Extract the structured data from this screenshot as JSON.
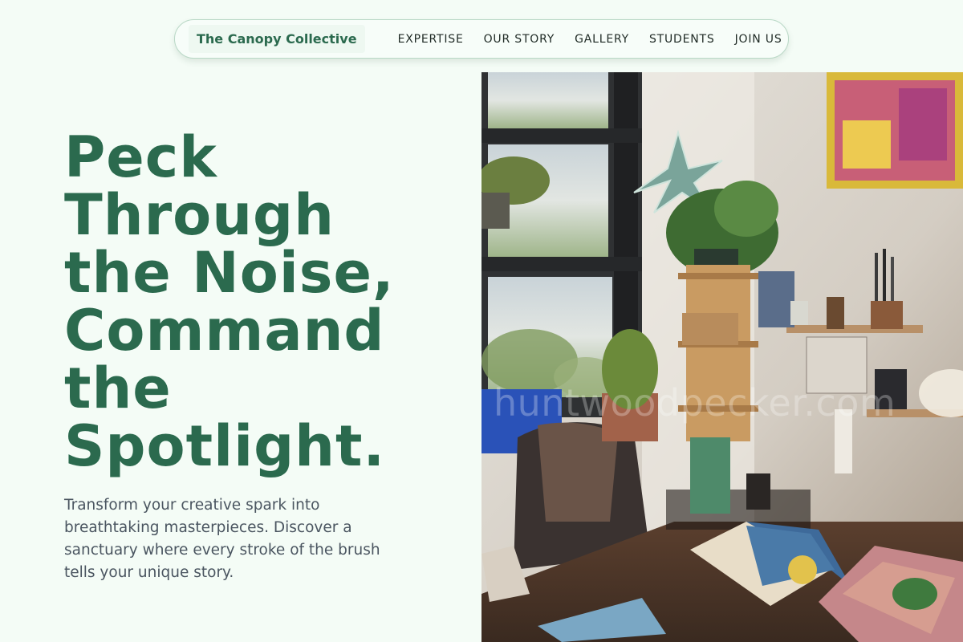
{
  "nav": {
    "brand": "The Canopy Collective",
    "links": [
      {
        "label": "EXPERTISE"
      },
      {
        "label": "OUR STORY"
      },
      {
        "label": "GALLERY"
      },
      {
        "label": "STUDENTS"
      },
      {
        "label": "JOIN US"
      }
    ]
  },
  "hero": {
    "title_lines": [
      "Peck",
      "Through",
      "the Noise,",
      "Command",
      "the",
      "Spotlight."
    ],
    "subtitle_lines": [
      "Transform your creative spark into",
      "breathtaking masterpieces. Discover a",
      "sanctuary where every stroke of the brush",
      "tells your unique story."
    ]
  },
  "image": {
    "watermark": "huntwoodpecker.com"
  },
  "colors": {
    "accent": "#2b6a4e",
    "background": "#f4fcf6",
    "body_text": "#4a5560"
  }
}
